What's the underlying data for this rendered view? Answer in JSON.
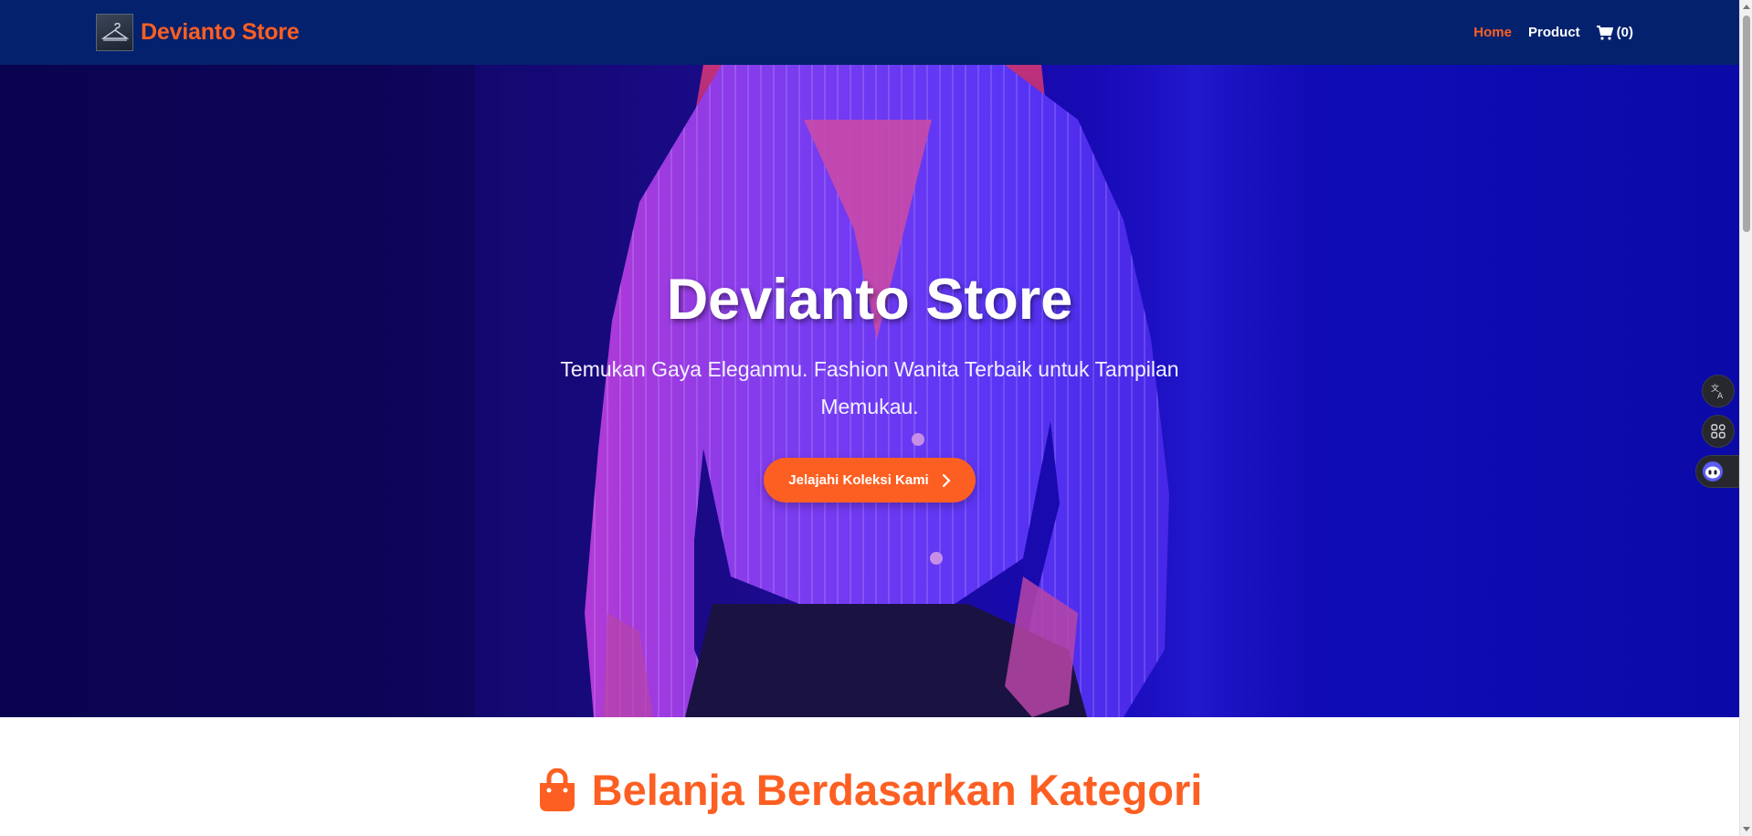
{
  "navbar": {
    "brand_name": "Devianto Store",
    "links": [
      {
        "label": "Home",
        "active": true
      },
      {
        "label": "Product",
        "active": false
      }
    ],
    "cart_count": "(0)"
  },
  "hero": {
    "title": "Devianto Store",
    "subtitle": "Temukan Gaya Eleganmu. Fashion Wanita Terbaik untuk Tampilan Memukau.",
    "cta_label": "Jelajahi Koleksi Kami"
  },
  "category_section": {
    "heading": "Belanja Berdasarkan Kategori"
  },
  "colors": {
    "navbar_bg": "#03216d",
    "accent": "#fd5f22",
    "hero_bg": "#1c0b8f"
  },
  "icons": {
    "cart": "shopping-cart-icon",
    "cta_arrow": "chevron-right-icon",
    "category": "shopping-bag-icon",
    "translate": "translate-icon",
    "apps": "apps-grid-icon",
    "bot": "assistant-bot-icon"
  }
}
